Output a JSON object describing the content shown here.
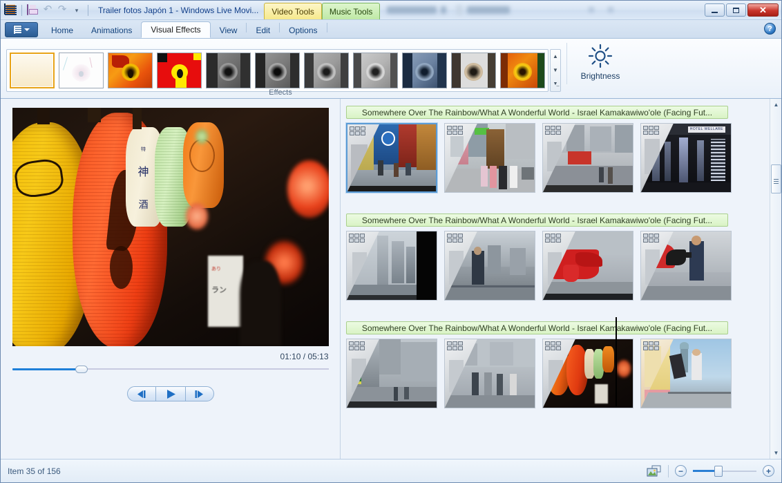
{
  "window": {
    "title": "Trailer fotos Japón 1 - Windows Live Movi...",
    "contextual_tabs": [
      {
        "label": "Video Tools",
        "color": "#f6e98c"
      },
      {
        "label": "Music Tools",
        "color": "#bfe9a6"
      }
    ],
    "quick_access": [
      {
        "name": "app-icon",
        "label": ""
      },
      {
        "name": "save-icon",
        "label": ""
      },
      {
        "name": "undo-icon",
        "label": "↶"
      },
      {
        "name": "redo-icon",
        "label": "↷"
      },
      {
        "name": "customize-qat-icon",
        "label": "▾"
      }
    ],
    "controls": {
      "minimize": "",
      "maximize": "",
      "close": "✕"
    }
  },
  "ribbon": {
    "file_button_label": "",
    "tabs": [
      {
        "label": "Home",
        "active": false
      },
      {
        "label": "Animations",
        "active": false
      },
      {
        "label": "Visual Effects",
        "active": true
      },
      {
        "label": "View",
        "active": false
      },
      {
        "label": "Edit",
        "active": false
      },
      {
        "label": "Options",
        "active": false
      }
    ],
    "help_label": "?",
    "group_label": "Effects",
    "effects": [
      {
        "name": "no-effect",
        "selected": true
      },
      {
        "name": "white-fade-effect",
        "selected": false
      },
      {
        "name": "warm-saturate-effect",
        "selected": false
      },
      {
        "name": "posterize-effect",
        "selected": false
      },
      {
        "name": "black-white-effect",
        "selected": false
      },
      {
        "name": "black-white-contrast-effect",
        "selected": false
      },
      {
        "name": "grayscale-soft-effect",
        "selected": false
      },
      {
        "name": "grayscale-bright-effect",
        "selected": false
      },
      {
        "name": "cyan-tone-effect",
        "selected": false
      },
      {
        "name": "sepia-effect",
        "selected": false
      },
      {
        "name": "orange-tone-effect",
        "selected": false
      }
    ],
    "gallery_scroll": {
      "up": "▲",
      "down": "▼",
      "more": "▬"
    },
    "brightness_label": "Brightness"
  },
  "preview": {
    "time_display": "01:10 / 05:13",
    "current_time": "01:10",
    "total_time": "05:13",
    "progress_percent": 22,
    "transport": [
      {
        "name": "previous-frame-button",
        "glyph": "◀❘"
      },
      {
        "name": "play-button",
        "glyph": "▶"
      },
      {
        "name": "next-frame-button",
        "glyph": "❘▶"
      }
    ]
  },
  "storyboard": {
    "music_track_label": "Somewhere Over The Rainbow/What A Wonderful World - Israel Kamakawiwo'ole (Facing Fut...",
    "rows": [
      {
        "music_label": "Somewhere Over The Rainbow/What A Wonderful World - Israel Kamakawiwo'ole (Facing Fut...",
        "clips": [
          {
            "name": "clip-street-signs",
            "selected": true
          },
          {
            "name": "clip-shopping-street",
            "selected": false
          },
          {
            "name": "clip-crossing-red-bus",
            "selected": false
          },
          {
            "name": "clip-hotel-sign-night",
            "selected": false
          }
        ]
      },
      {
        "music_label": "Somewhere Over The Rainbow/What A Wonderful World - Israel Kamakawiwo'ole (Facing Fut...",
        "clips": [
          {
            "name": "clip-tower-skyline",
            "selected": false
          },
          {
            "name": "clip-man-on-bridge",
            "selected": false
          },
          {
            "name": "clip-red-sculpture",
            "selected": false
          },
          {
            "name": "clip-man-graffiti-wall",
            "selected": false
          }
        ]
      },
      {
        "music_label": "Somewhere Over The Rainbow/What A Wonderful World - Israel Kamakawiwo'ole (Facing Fut...",
        "clips": [
          {
            "name": "clip-city-street-day",
            "selected": false
          },
          {
            "name": "clip-crowd-walking",
            "selected": false
          },
          {
            "name": "clip-red-lanterns",
            "selected": false
          },
          {
            "name": "clip-jumping-people",
            "selected": false
          }
        ]
      }
    ],
    "scrollbar": {
      "up": "▲",
      "down": "▼"
    }
  },
  "statusbar": {
    "item_text": "Item 35 of 156",
    "item_index": 35,
    "item_total": 156,
    "zoom_out_label": "−",
    "zoom_in_label": "+",
    "zoom_percent": 40,
    "view_icon_name": "thumbnail-view-icon"
  }
}
